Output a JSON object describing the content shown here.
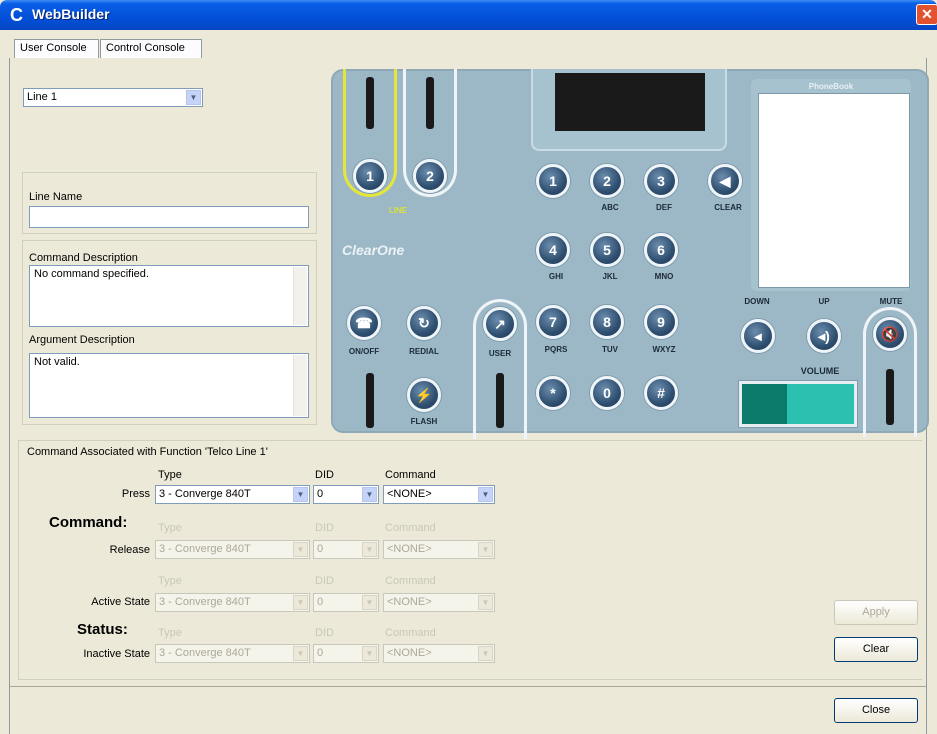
{
  "window": {
    "title": "WebBuilder",
    "close_glyph": "✕"
  },
  "tabs": [
    {
      "label": "User Console"
    },
    {
      "label": "Control Console"
    }
  ],
  "line_select": {
    "value": "Line 1"
  },
  "line_name": {
    "label": "Line Name",
    "value": ""
  },
  "command_description": {
    "label": "Command Description",
    "value": "No command specified."
  },
  "argument_description": {
    "label": "Argument Description",
    "value": "Not valid."
  },
  "phone": {
    "line_buttons": [
      "1",
      "2"
    ],
    "line_label": "LINE",
    "brand": "ClearOne",
    "phonebook_title": "PhoneBook",
    "keypad": [
      {
        "key": "1",
        "sub": ""
      },
      {
        "key": "2",
        "sub": "ABC"
      },
      {
        "key": "3",
        "sub": "DEF"
      },
      {
        "key": "4",
        "sub": "GHI"
      },
      {
        "key": "5",
        "sub": "JKL"
      },
      {
        "key": "6",
        "sub": "MNO"
      },
      {
        "key": "7",
        "sub": "PQRS"
      },
      {
        "key": "8",
        "sub": "TUV"
      },
      {
        "key": "9",
        "sub": "WXYZ"
      },
      {
        "key": "*",
        "sub": ""
      },
      {
        "key": "0",
        "sub": ""
      },
      {
        "key": "#",
        "sub": ""
      }
    ],
    "clear_label": "CLEAR",
    "onoff_label": "ON/OFF",
    "redial_label": "REDIAL",
    "flash_label": "FLASH",
    "user_label": "USER",
    "down_label": "DOWN",
    "up_label": "UP",
    "mute_label": "MUTE",
    "volume_label": "VOLUME",
    "volume_level": 0.4
  },
  "command_section": {
    "heading": "Command Associated with Function 'Telco Line 1'",
    "command_title": "Command:",
    "status_title": "Status:",
    "col_type": "Type",
    "col_did": "DID",
    "col_command": "Command",
    "rows": [
      {
        "label": "Press",
        "type": "3 - Converge 840T",
        "did": "0",
        "command": "<NONE>",
        "enabled": true
      },
      {
        "label": "Release",
        "type": "3 - Converge 840T",
        "did": "0",
        "command": "<NONE>",
        "enabled": false
      },
      {
        "label": "Active State",
        "type": "3 - Converge 840T",
        "did": "0",
        "command": "<NONE>",
        "enabled": false
      },
      {
        "label": "Inactive State",
        "type": "3 - Converge 840T",
        "did": "0",
        "command": "<NONE>",
        "enabled": false
      }
    ]
  },
  "buttons": {
    "apply": "Apply",
    "clear": "Clear",
    "close": "Close"
  }
}
